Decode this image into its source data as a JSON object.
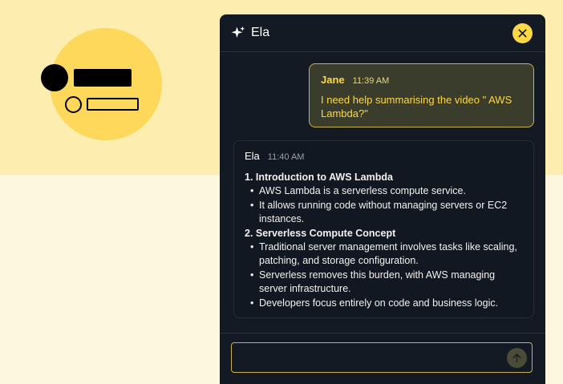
{
  "colors": {
    "accent": "#fcd846",
    "panel_bg": "#141a23",
    "user_bubble_bg": "#3a3d2c",
    "page_bg_top": "#fdeeb0",
    "page_bg_bottom": "#fef7df"
  },
  "header": {
    "title": "Ela",
    "icon": "sparkle-icon",
    "close_icon": "close-icon"
  },
  "messages": {
    "user": {
      "name": "Jane",
      "time": "11:39 AM",
      "text": "I need help summarising the video \" AWS Lambda?\""
    },
    "bot": {
      "name": "Ela",
      "time": "11:40 AM",
      "sections": [
        {
          "title": "1. Introduction to AWS Lambda",
          "bullets": [
            "AWS Lambda is a serverless compute service.",
            "It allows running code without managing servers or EC2 instances."
          ]
        },
        {
          "title": "2. Serverless Compute Concept",
          "bullets": [
            "Traditional server management involves tasks like scaling, patching, and storage configuration.",
            "Serverless removes this burden, with AWS managing server infrastructure.",
            "Developers focus entirely on code and business logic."
          ]
        }
      ]
    }
  },
  "composer": {
    "placeholder": "",
    "send_icon": "arrow-up-icon"
  }
}
